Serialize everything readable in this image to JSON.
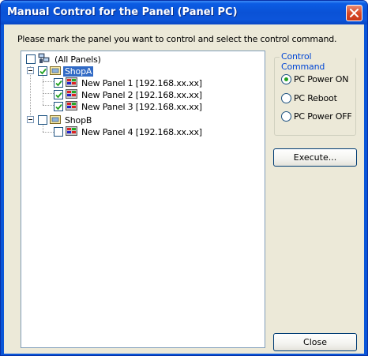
{
  "window": {
    "title": "Manual Control for the Panel (Panel PC)"
  },
  "instruction": "Please mark the panel you want to control and select the control command.",
  "tree": {
    "root": {
      "label": "(All Panels)",
      "checked": false
    },
    "groups": [
      {
        "label": "ShopA",
        "checked": true,
        "selected": true,
        "panels": [
          {
            "label": "New Panel 1 [192.168.xx.xx]",
            "checked": true
          },
          {
            "label": "New Panel 2 [192.168.xx.xx]",
            "checked": true
          },
          {
            "label": "New Panel 3 [192.168.xx.xx]",
            "checked": true
          }
        ]
      },
      {
        "label": "ShopB",
        "checked": false,
        "selected": false,
        "panels": [
          {
            "label": "New Panel 4 [192.168.xx.xx]",
            "checked": false
          }
        ]
      }
    ]
  },
  "control_command": {
    "title": "Control Command",
    "options": [
      {
        "label": "PC Power ON",
        "selected": true
      },
      {
        "label": "PC Reboot",
        "selected": false
      },
      {
        "label": "PC Power OFF",
        "selected": false
      }
    ]
  },
  "buttons": {
    "execute": "Execute...",
    "close": "Close"
  },
  "colors": {
    "titlebar": "#0a52d6",
    "dialog_bg": "#ece9d8",
    "selection": "#316ac5",
    "group_title": "#0046d5",
    "radio_dot": "#21a121",
    "check_mark": "#21a121"
  }
}
